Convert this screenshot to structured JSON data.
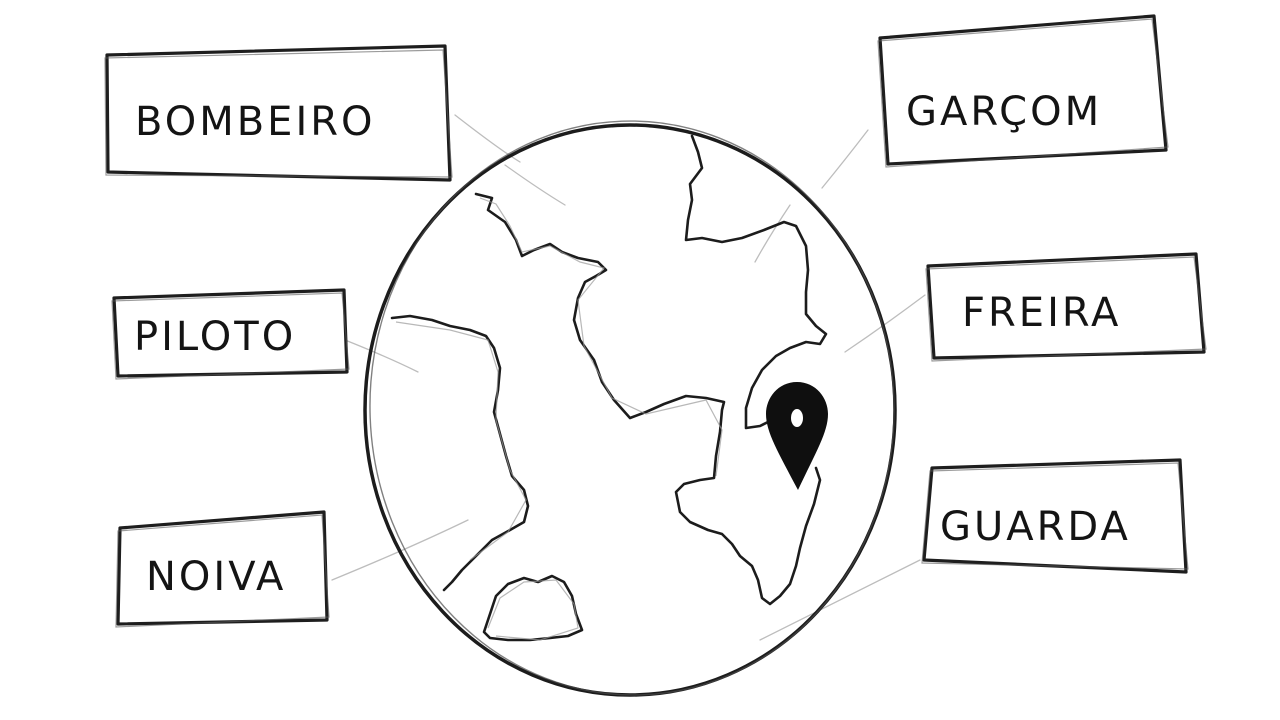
{
  "labels": {
    "bombeiro": "BOMBEIRO",
    "piloto": "PILOTO",
    "noiva": "NOIVA",
    "garcom": "GARÇOM",
    "freira": "FREIRA",
    "guarda": "GUARDA"
  },
  "icons": {
    "globe": "globe-icon",
    "pin": "map-pin-icon"
  },
  "colors": {
    "ink": "#1c1c1c",
    "connector": "#bdbdbd",
    "background": "#ffffff"
  }
}
